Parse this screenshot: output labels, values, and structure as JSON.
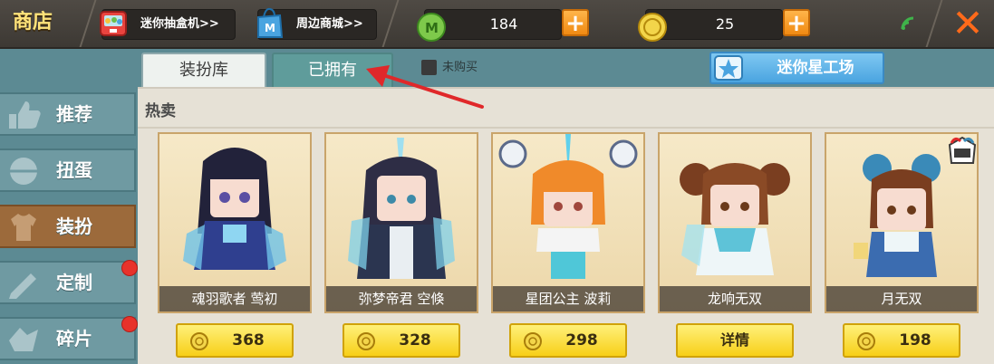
{
  "topbar": {
    "title": "商店",
    "gacha_link": "迷你抽盒机>>",
    "mall_link": "周边商城>>",
    "currency_green": "184",
    "currency_gold": "25"
  },
  "sidebar": {
    "items": [
      {
        "label": "推荐",
        "active": false,
        "dot": false
      },
      {
        "label": "扭蛋",
        "active": false,
        "dot": false
      },
      {
        "label": "装扮",
        "active": true,
        "dot": false
      },
      {
        "label": "定制",
        "active": false,
        "dot": true
      },
      {
        "label": "碎片",
        "active": false,
        "dot": true
      }
    ]
  },
  "tabs": {
    "wardrobe": "装扮库",
    "owned": "已拥有"
  },
  "filter": {
    "unpurchased_label": "未购买"
  },
  "workshop_button": "迷你星工场",
  "section": {
    "title": "热卖"
  },
  "items": [
    {
      "name": "魂羽歌者 莺初",
      "price": "368"
    },
    {
      "name": "弥梦帝君 空倏",
      "price": "328"
    },
    {
      "name": "星团公主 波莉",
      "price": "298"
    },
    {
      "name": "龙响无双",
      "action": "详情"
    },
    {
      "name": "月无双",
      "price": "198"
    }
  ],
  "colors": {
    "accent_orange": "#f08a12",
    "gold_button": "#f7cf18",
    "sidebar_active": "#9c6a3b",
    "annotation_arrow": "#e0282a"
  }
}
